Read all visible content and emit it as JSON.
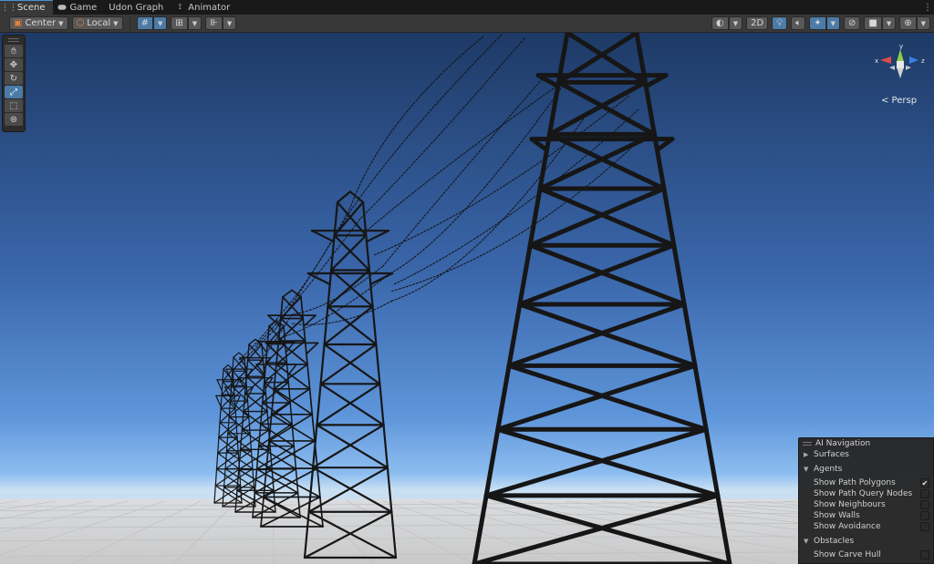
{
  "tabs": [
    {
      "label": "Scene",
      "icon": "grid-icon",
      "active": true
    },
    {
      "label": "Game",
      "icon": "gamepad-icon",
      "active": false
    },
    {
      "label": "Udon Graph",
      "icon": "",
      "active": false
    },
    {
      "label": "Animator",
      "icon": "animator-icon",
      "active": false
    }
  ],
  "toolbar": {
    "pivot_label": "Center",
    "space_label": "Local",
    "mode_2d_label": "2D"
  },
  "gizmo": {
    "x_label": "x",
    "y_label": "y",
    "z_label": "z",
    "persp_label": "< Persp"
  },
  "ai_navigation": {
    "title": "AI Navigation",
    "surfaces_label": "Surfaces",
    "agents_label": "Agents",
    "agent_options": [
      {
        "label": "Show Path Polygons",
        "checked": true
      },
      {
        "label": "Show Path Query Nodes",
        "checked": false
      },
      {
        "label": "Show Neighbours",
        "checked": false
      },
      {
        "label": "Show Walls",
        "checked": false
      },
      {
        "label": "Show Avoidance",
        "checked": false
      }
    ],
    "obstacles_label": "Obstacles",
    "obstacle_options": [
      {
        "label": "Show Carve Hull",
        "checked": false
      }
    ]
  },
  "colors": {
    "sky_top": "#1f3b66",
    "sky_horizon": "#7fb2e8",
    "ground": "#d6d6d6",
    "accent": "#4c7ba8",
    "tower": "#161616"
  }
}
